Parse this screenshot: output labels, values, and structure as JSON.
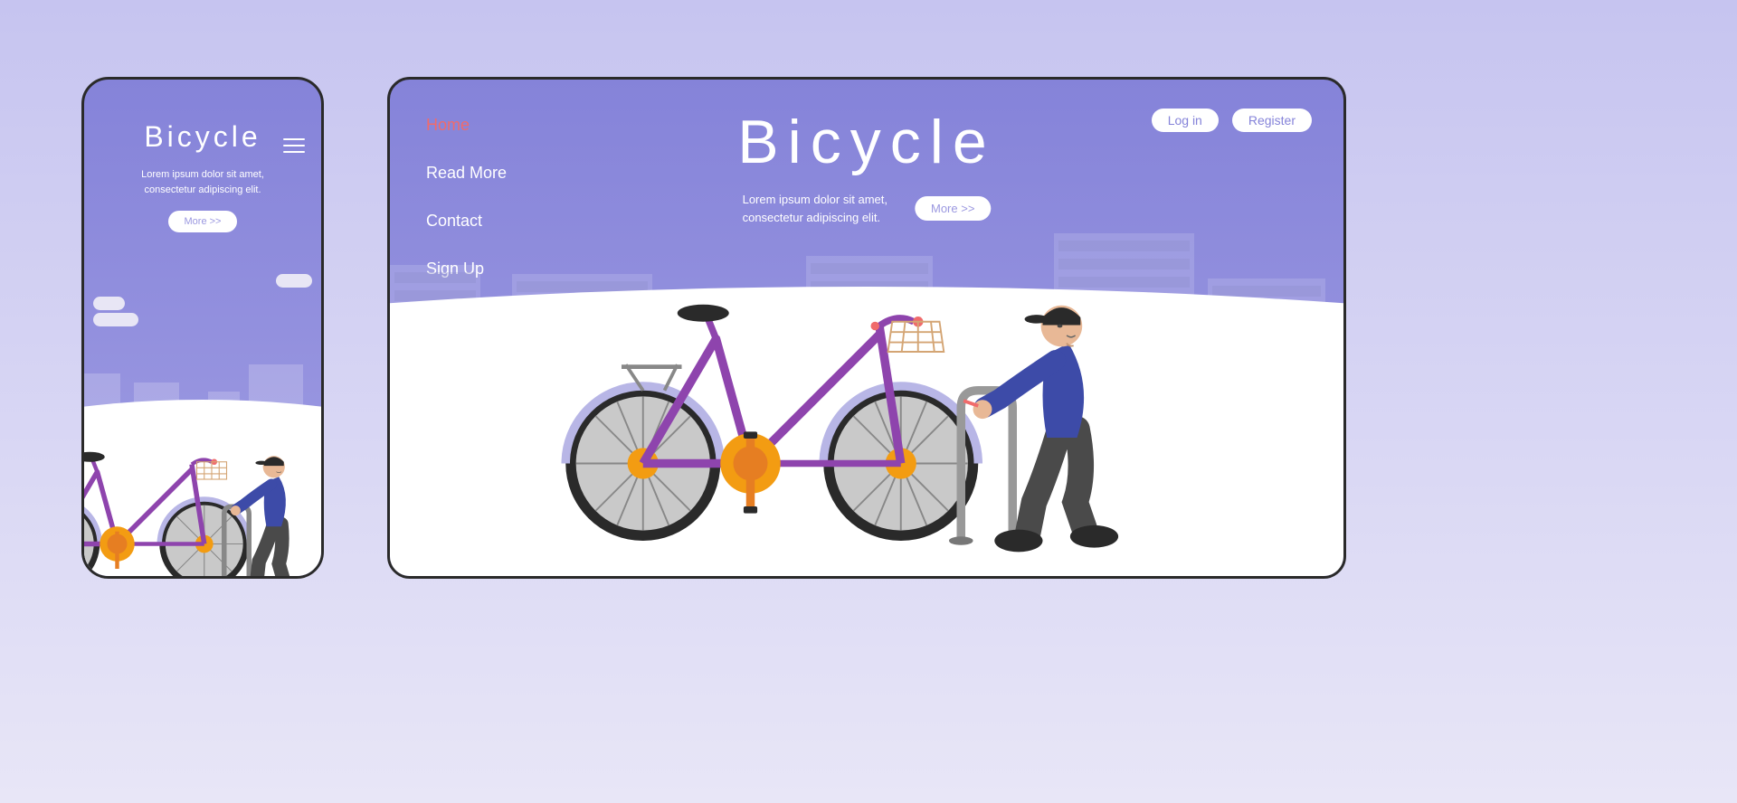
{
  "mobile": {
    "title": "Bicycle",
    "subtitle_line1": "Lorem ipsum dolor sit amet,",
    "subtitle_line2": "consectetur adipiscing elit.",
    "more_button": "More >>",
    "active_dot_index": 3,
    "dot_count": 5
  },
  "desktop": {
    "nav": {
      "items": [
        {
          "label": "Home",
          "active": true
        },
        {
          "label": "Read More",
          "active": false
        },
        {
          "label": "Contact",
          "active": false
        },
        {
          "label": "Sign Up",
          "active": false
        }
      ]
    },
    "header": {
      "login": "Log in",
      "register": "Register"
    },
    "title": "Bicycle",
    "subtitle_line1": "Lorem ipsum dolor sit amet,",
    "subtitle_line2": "consectetur adipiscing elit.",
    "more_button": "More >>"
  },
  "colors": {
    "accent": "#f06b6b",
    "primary": "#8583d9",
    "bike_frame": "#8e44ad",
    "bike_accent": "#f39c12",
    "person_shirt": "#3d4ba8"
  }
}
